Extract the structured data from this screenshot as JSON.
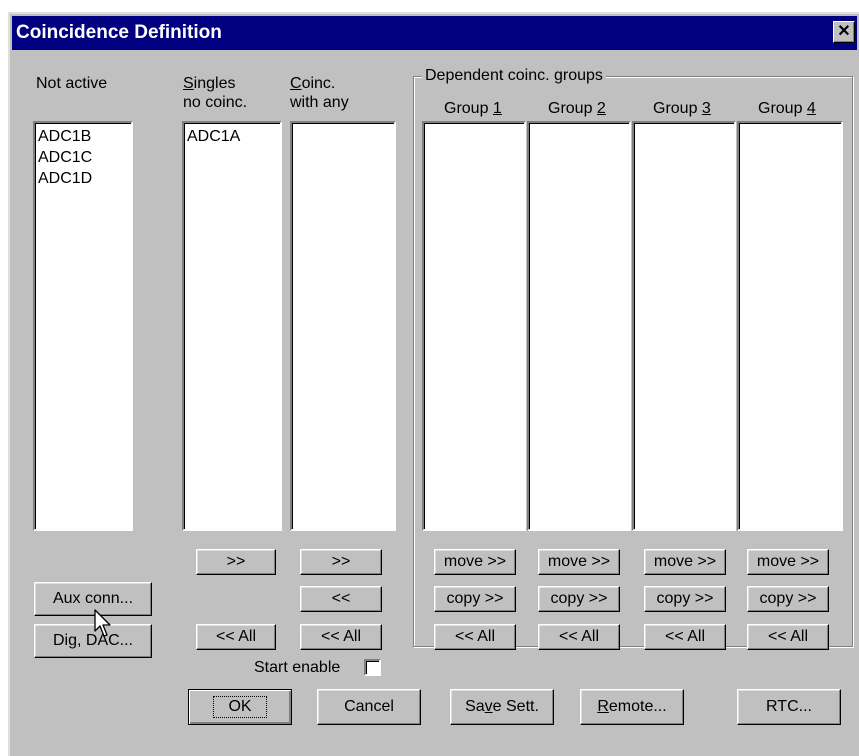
{
  "window": {
    "title": "Coincidence Definition",
    "close_glyph": "✕"
  },
  "columns": {
    "not_active": {
      "label": "Not active",
      "items": [
        "ADC1B",
        "ADC1C",
        "ADC1D"
      ]
    },
    "singles": {
      "label_line1": "Singles",
      "label_line2": "no coinc.",
      "items": [
        "ADC1A"
      ]
    },
    "coinc_any": {
      "label_line1": "Coinc.",
      "label_line2": "with any",
      "items": []
    }
  },
  "dependent_groups": {
    "caption": "Dependent coinc. groups",
    "groups": [
      {
        "prefix": "Group ",
        "number": "1"
      },
      {
        "prefix": "Group ",
        "number": "2"
      },
      {
        "prefix": "Group ",
        "number": "3"
      },
      {
        "prefix": "Group ",
        "number": "4"
      }
    ],
    "move_label": "move >>",
    "copy_label": "copy >>",
    "all_back_label": "<< All"
  },
  "buttons": {
    "aux_conn": "Aux conn...",
    "dig_dac": "Dig, DAC...",
    "singles_forward": ">>",
    "singles_all_back": "<< All",
    "coinc_forward": ">>",
    "coinc_back": "<<",
    "coinc_all_back": "<< All",
    "ok": "OK",
    "cancel": "Cancel",
    "save_sett": "Save Sett.",
    "remote": "Remote...",
    "rtc": "RTC..."
  },
  "start_enable": {
    "label": "Start enable",
    "checked": false
  },
  "cursor": {
    "icon": "arrow-pointer-icon"
  }
}
